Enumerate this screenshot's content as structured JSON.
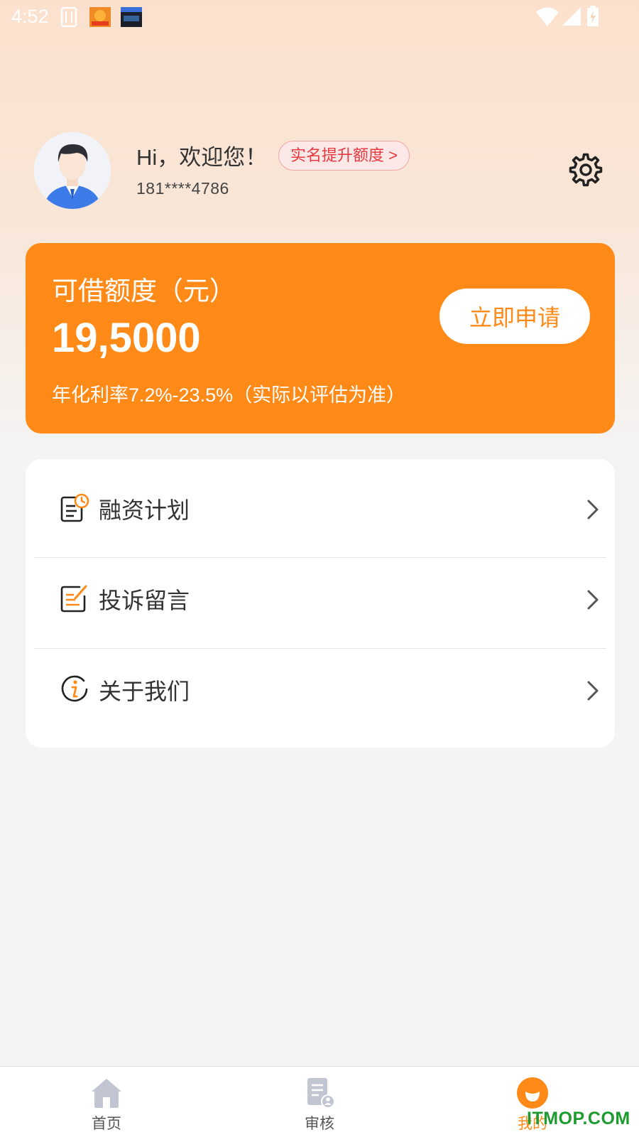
{
  "status_bar": {
    "time": "4:52",
    "icons": [
      "sim-card-icon",
      "app-notification-icon",
      "calendar-notification-icon",
      "wifi-icon",
      "cell-signal-icon",
      "battery-icon"
    ]
  },
  "header": {
    "greeting": "Hi，欢迎您！",
    "badge_label": "实名提升额度 >",
    "phone": "181****4786",
    "settings_icon": "gear-icon"
  },
  "credit_card": {
    "title": "可借额度（元）",
    "amount": "19,5000",
    "apply_label": "立即申请",
    "rate_text": "年化利率7.2%-23.5%（实际以评估为准）"
  },
  "menu": {
    "items": [
      {
        "label": "融资计划",
        "icon": "finance-plan-icon"
      },
      {
        "label": "投诉留言",
        "icon": "complaint-icon"
      },
      {
        "label": "关于我们",
        "icon": "info-icon"
      }
    ]
  },
  "bottom_nav": {
    "items": [
      {
        "label": "首页",
        "icon": "home-icon"
      },
      {
        "label": "审核",
        "icon": "review-icon"
      },
      {
        "label": "我的",
        "icon": "profile-icon",
        "active": true
      }
    ]
  },
  "watermark": "ITMOP.COM",
  "colors": {
    "accent": "#ff8a17",
    "badge_text": "#e8383d",
    "watermark": "#1e9b2e"
  }
}
